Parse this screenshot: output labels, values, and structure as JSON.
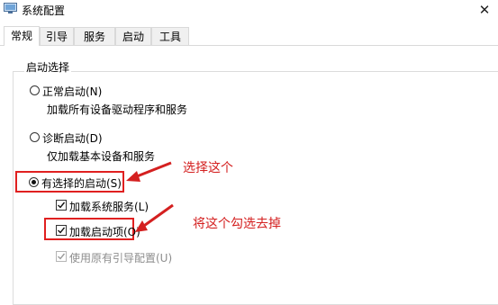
{
  "window": {
    "title": "系统配置"
  },
  "tabs": [
    {
      "label": "常规",
      "active": true
    },
    {
      "label": "引导",
      "active": false
    },
    {
      "label": "服务",
      "active": false
    },
    {
      "label": "启动",
      "active": false
    },
    {
      "label": "工具",
      "active": false
    }
  ],
  "startup_selection": {
    "group_label": "启动选择",
    "normal": {
      "label": "正常启动(N)",
      "description": "加载所有设备驱动程序和服务",
      "selected": false
    },
    "diagnostic": {
      "label": "诊断启动(D)",
      "description": "仅加载基本设备和服务",
      "selected": false
    },
    "selective": {
      "label": "有选择的启动(S)",
      "selected": true,
      "options": {
        "load_system_services": {
          "label": "加载系统服务(L)",
          "checked": true
        },
        "load_startup_items": {
          "label": "加载启动项(O)",
          "checked": true
        },
        "use_original_boot_config": {
          "label": "使用原有引导配置(U)",
          "checked": true,
          "disabled": true
        }
      }
    }
  },
  "annotations": {
    "select_this": "选择这个",
    "uncheck_this": "将这个勾选去掉",
    "color": "#d42020"
  },
  "icons": {
    "app": "system-config-icon",
    "close": "close-icon",
    "check": "checkmark-icon"
  }
}
